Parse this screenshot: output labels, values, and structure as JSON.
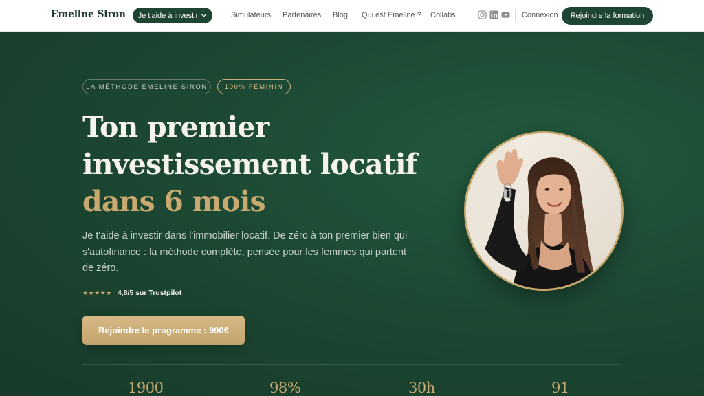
{
  "nav": {
    "logo": "Emeline Siron",
    "dropdown_label": "Je t'aide à investir",
    "links": [
      "Simulateurs",
      "Partenaires",
      "Blog",
      "Qui est Emeline ?",
      "Collabs"
    ],
    "social_icons": [
      "instagram-icon",
      "linkedin-icon",
      "youtube-icon"
    ],
    "login": "Connexion",
    "cta": "Rejoindre la formation"
  },
  "hero": {
    "badge_method": "LA MÉTHODE EMELINE SIRON",
    "badge_female": "100% FÉMININ",
    "headline_line1": "Ton premier",
    "headline_line2": "investissement locatif",
    "headline_line3": "dans 6 mois",
    "lead": "Je t'aide à investir dans l'immobilier locatif. De zéro à ton premier bien qui s'autofinance : la méthode complète, pensée pour les femmes qui partent de zéro.",
    "stars": "★★★★★",
    "rating": "4,8/5 sur Trustpilot",
    "cta": "Rejoindre le programme : 990€"
  },
  "stats": [
    "1900",
    "98%",
    "30h",
    "91"
  ],
  "colors": {
    "green_dark": "#1e4531",
    "hero_bg": "#1d4a34",
    "gold": "#c8aa70",
    "white": "#ffffff"
  }
}
